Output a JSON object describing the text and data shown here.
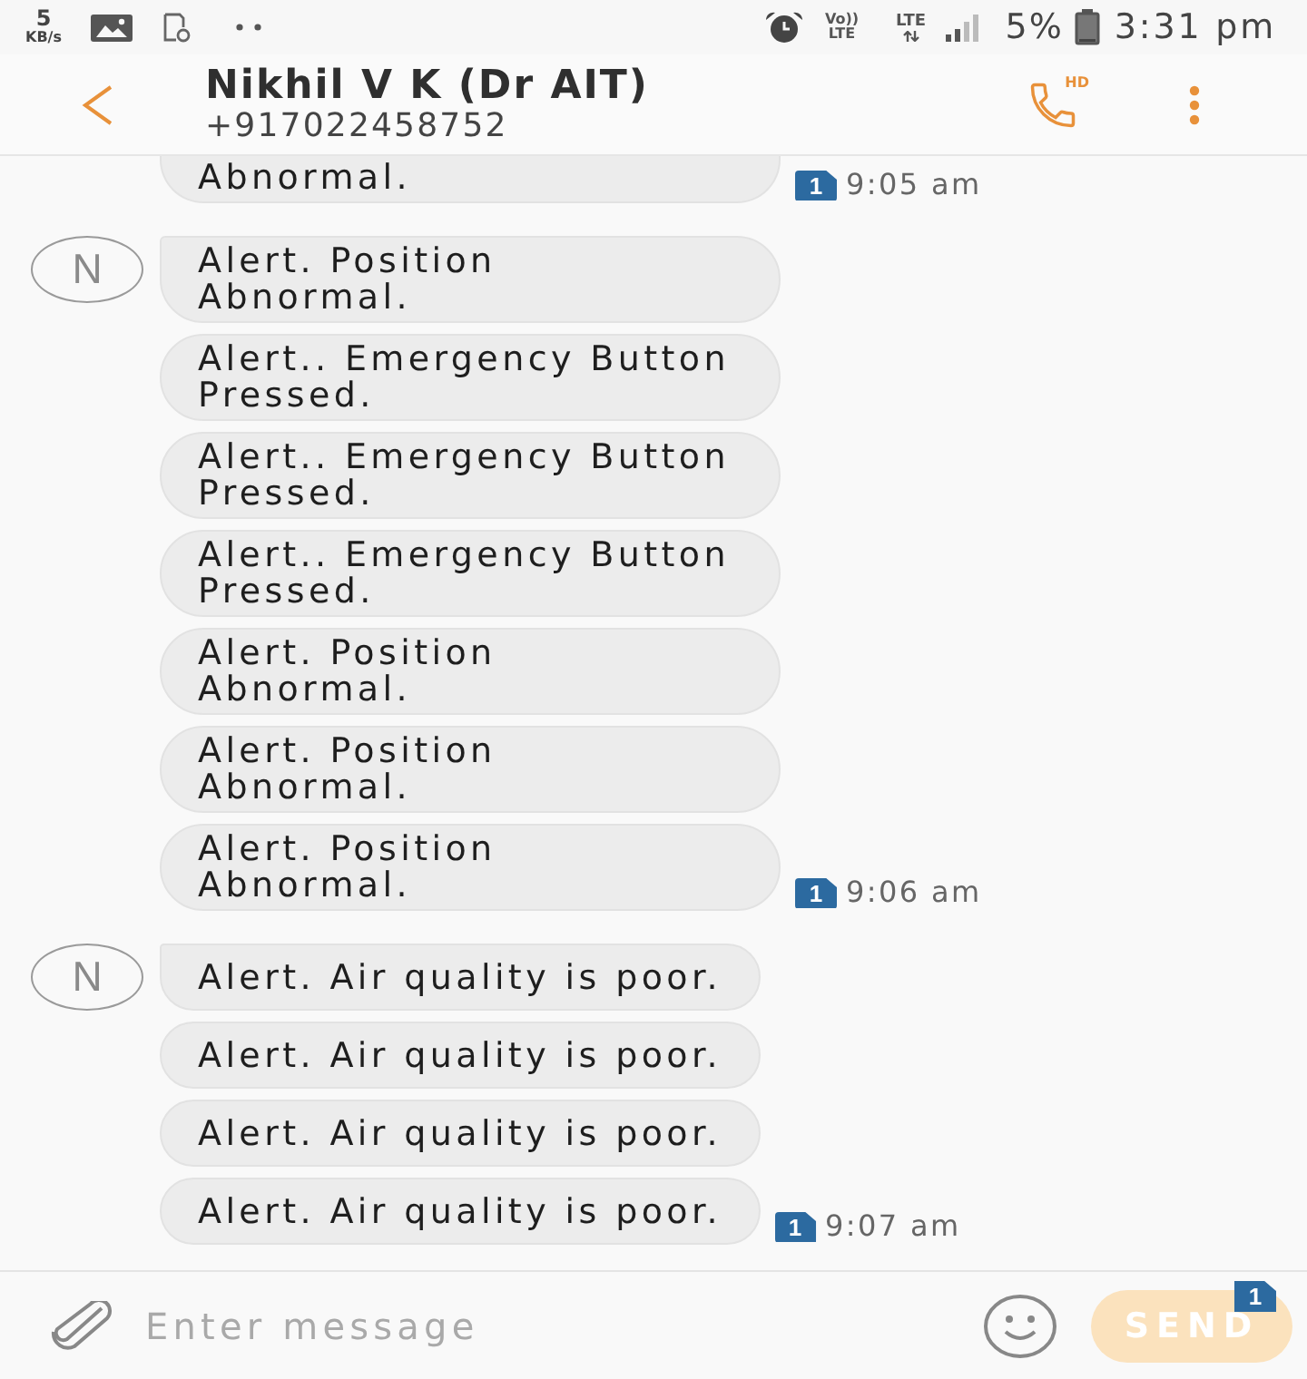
{
  "status_bar": {
    "speed": "5",
    "speed_unit": "KB/s",
    "volte": "Vo))",
    "volte_sub": "LTE",
    "network": "LTE",
    "battery": "5%",
    "time": "3:31 pm"
  },
  "header": {
    "title": "Nikhil V K (Dr AIT)",
    "subtitle": "+917022458752",
    "call_badge": "HD"
  },
  "groups": [
    {
      "top_cut": true,
      "messages": [
        "Abnormal."
      ],
      "sim": "1",
      "time": "9:05 am"
    },
    {
      "top_cut": false,
      "avatar": "N",
      "messages": [
        "Alert. Position\nAbnormal.",
        "Alert.. Emergency Button Pressed.",
        "Alert.. Emergency Button Pressed.",
        "Alert.. Emergency Button Pressed.",
        "Alert. Position\nAbnormal.",
        "Alert. Position\nAbnormal.",
        "Alert. Position\nAbnormal."
      ],
      "sim": "1",
      "time": "9:06 am"
    },
    {
      "top_cut": false,
      "avatar": "N",
      "messages": [
        "Alert. Air quality is poor.",
        "Alert. Air quality is poor.",
        "Alert. Air quality is poor.",
        "Alert. Air quality is poor."
      ],
      "sim": "1",
      "time": "9:07 am"
    }
  ],
  "composer": {
    "placeholder": "Enter message",
    "send": "SEND",
    "send_disabled": true,
    "send_badge": "1"
  }
}
